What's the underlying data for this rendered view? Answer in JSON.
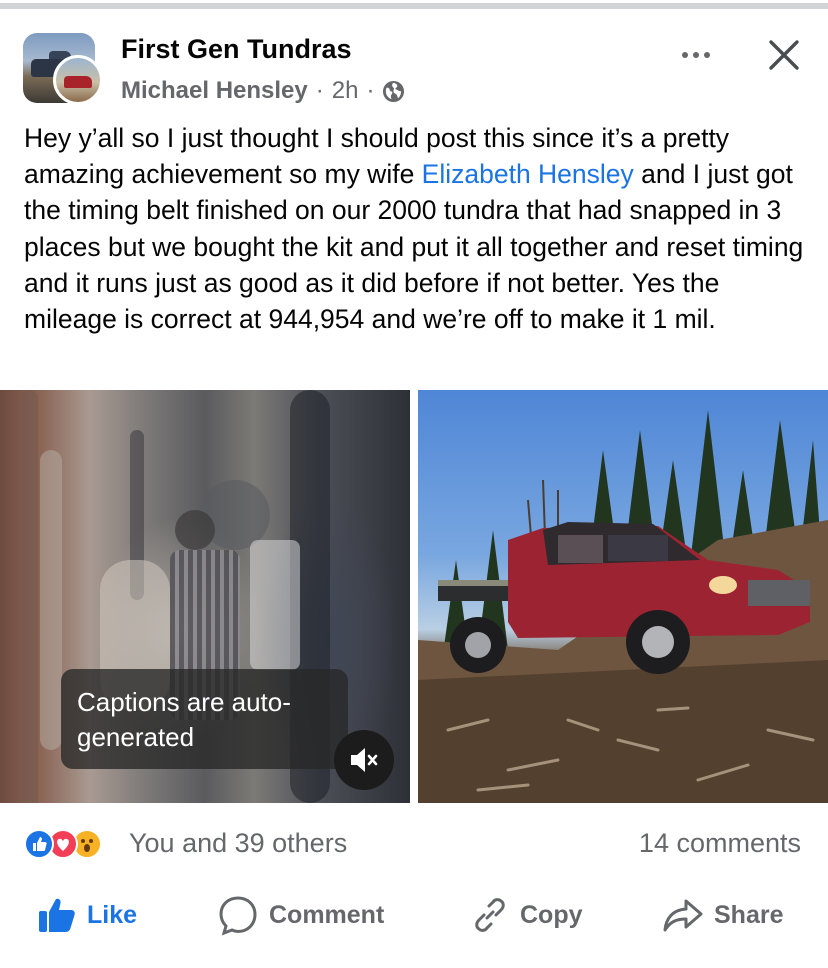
{
  "post": {
    "group_name": "First Gen Tundras",
    "author": "Michael Hensley",
    "time": "2h",
    "separator": "·",
    "visibility_icon": "globe-icon",
    "text_part1": "Hey y’all so I just thought I should post this since it’s a pretty amazing achievement so my wife ",
    "mention": "Elizabeth Hensley",
    "text_part2": " and I just got the timing belt finished on our 2000 tundra that had snapped in 3 places but we bought the kit and put it all together and reset timing and it runs just as good as it did before if not better. Yes the mileage is correct at 944,954 and we’re off to make it 1 mil."
  },
  "media": {
    "video_caption_notice": "Captions are auto-generated",
    "mute_icon": "speaker-muted-icon"
  },
  "reactions": {
    "icons": [
      "like-reaction-icon",
      "love-reaction-icon",
      "wow-reaction-icon"
    ],
    "summary": "You and 39 others",
    "comments": "14 comments"
  },
  "actions": {
    "like": "Like",
    "comment": "Comment",
    "copy": "Copy",
    "share": "Share"
  },
  "colors": {
    "accent": "#1b74e4",
    "secondary_text": "#65676b",
    "love": "#f33e58",
    "wow": "#f7b125"
  }
}
